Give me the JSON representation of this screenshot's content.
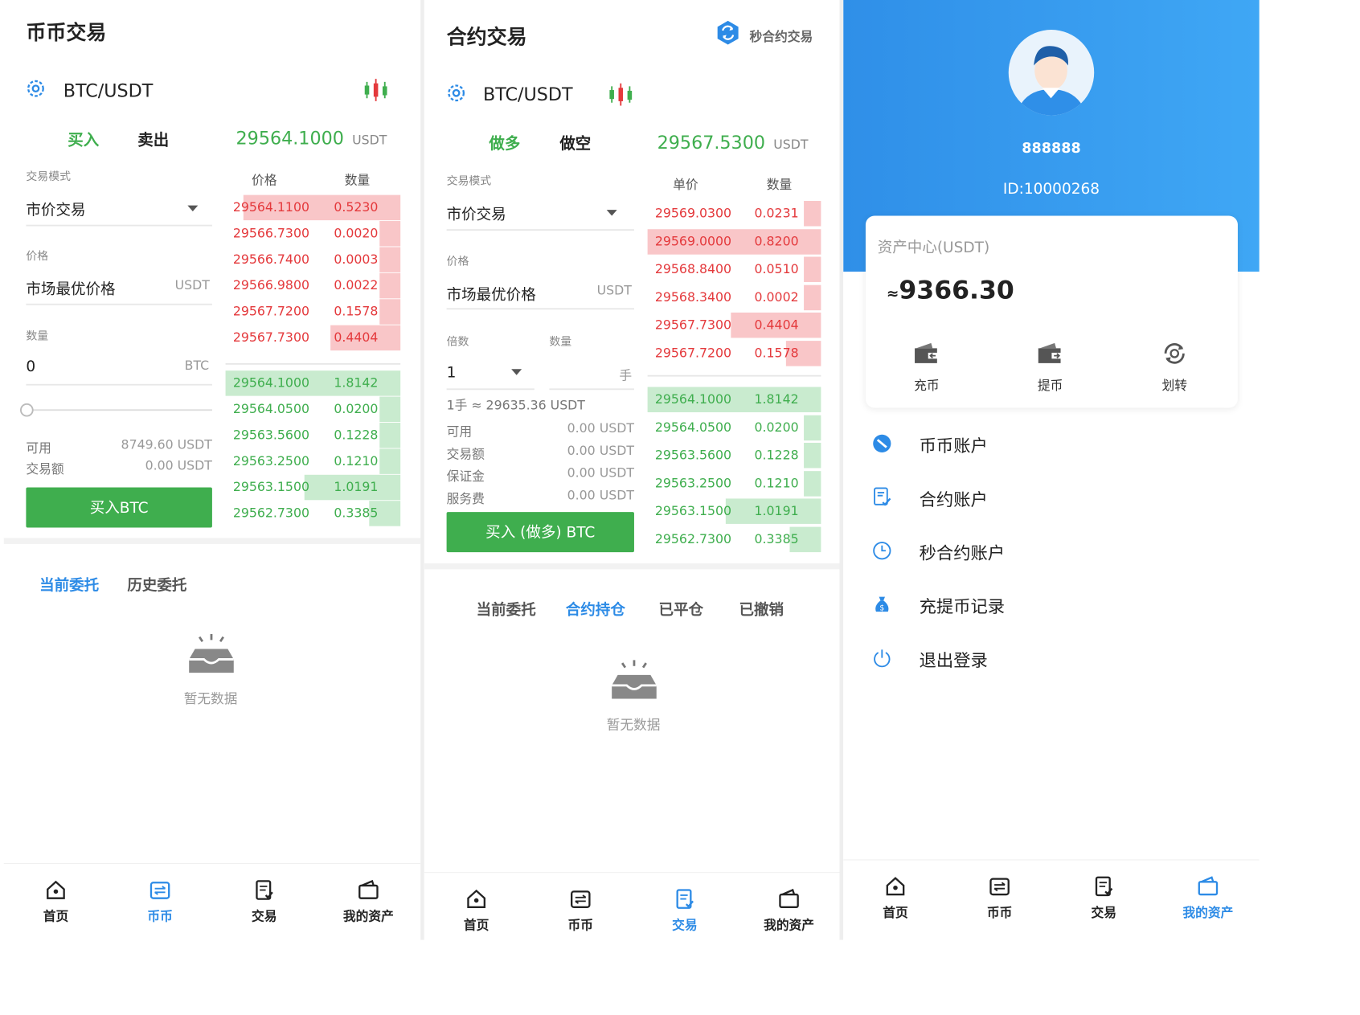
{
  "colors": {
    "green": "#3fae4e",
    "red": "#e4393c",
    "blue": "#2d8be6",
    "ask_bg": "#f9c6c8",
    "bid_bg": "#c9ebcf"
  },
  "spot": {
    "title": "币币交易",
    "pair": "BTC/USDT",
    "tab_buy": "买入",
    "tab_sell": "卖出",
    "last_price": "29564.1000",
    "price_unit": "USDT",
    "mode_label": "交易模式",
    "mode_value": "市价交易",
    "price_label": "价格",
    "price_value": "市场最优价格",
    "price_field_unit": "USDT",
    "qty_label": "数量",
    "qty_value": "0",
    "qty_unit": "BTC",
    "available_label": "可用",
    "available_value": "8749.60 USDT",
    "amount_label": "交易额",
    "amount_value": "0.00 USDT",
    "submit": "买入BTC",
    "ob_head_price": "价格",
    "ob_head_qty": "数量",
    "asks": [
      {
        "price": "29564.1100",
        "qty": "0.5230",
        "depth": 0.9
      },
      {
        "price": "29566.7300",
        "qty": "0.0020",
        "depth": 0.12
      },
      {
        "price": "29566.7400",
        "qty": "0.0003",
        "depth": 0.12
      },
      {
        "price": "29566.9800",
        "qty": "0.0022",
        "depth": 0.12
      },
      {
        "price": "29567.7200",
        "qty": "0.1578",
        "depth": 0.12
      },
      {
        "price": "29567.7300",
        "qty": "0.4404",
        "depth": 0.4
      }
    ],
    "bids": [
      {
        "price": "29564.1000",
        "qty": "1.8142",
        "depth": 1.0
      },
      {
        "price": "29564.0500",
        "qty": "0.0200",
        "depth": 0.12
      },
      {
        "price": "29563.5600",
        "qty": "0.1228",
        "depth": 0.12
      },
      {
        "price": "29563.2500",
        "qty": "0.1210",
        "depth": 0.12
      },
      {
        "price": "29563.1500",
        "qty": "1.0191",
        "depth": 0.55
      },
      {
        "price": "29562.7300",
        "qty": "0.3385",
        "depth": 0.18
      }
    ],
    "orders_tabs": [
      "当前委托",
      "历史委托"
    ],
    "empty": "暂无数据"
  },
  "futures": {
    "title": "合约交易",
    "second_contract": "秒合约交易",
    "pair": "BTC/USDT",
    "tab_long": "做多",
    "tab_short": "做空",
    "last_price": "29567.5300",
    "price_unit": "USDT",
    "mode_label": "交易模式",
    "mode_value": "市价交易",
    "price_label": "价格",
    "price_value": "市场最优价格",
    "price_field_unit": "USDT",
    "leverage_label": "倍数",
    "leverage_value": "1",
    "qty_label": "数量",
    "qty_unit": "手",
    "lot_note": "1手 ≈ 29635.36 USDT",
    "info": [
      {
        "label": "可用",
        "value": "0.00 USDT"
      },
      {
        "label": "交易额",
        "value": "0.00 USDT"
      },
      {
        "label": "保证金",
        "value": "0.00 USDT"
      },
      {
        "label": "服务费",
        "value": "0.00 USDT"
      }
    ],
    "submit": "买入 (做多) BTC",
    "ob_head_price": "单价",
    "ob_head_qty": "数量",
    "asks": [
      {
        "price": "29569.0300",
        "qty": "0.0231",
        "depth": 0.1
      },
      {
        "price": "29569.0000",
        "qty": "0.8200",
        "depth": 1.0
      },
      {
        "price": "29568.8400",
        "qty": "0.0510",
        "depth": 0.1
      },
      {
        "price": "29568.3400",
        "qty": "0.0002",
        "depth": 0.1
      },
      {
        "price": "29567.7300",
        "qty": "0.4404",
        "depth": 0.52
      },
      {
        "price": "29567.7200",
        "qty": "0.1578",
        "depth": 0.2
      }
    ],
    "bids": [
      {
        "price": "29564.1000",
        "qty": "1.8142",
        "depth": 1.0
      },
      {
        "price": "29564.0500",
        "qty": "0.0200",
        "depth": 0.1
      },
      {
        "price": "29563.5600",
        "qty": "0.1228",
        "depth": 0.1
      },
      {
        "price": "29563.2500",
        "qty": "0.1210",
        "depth": 0.1
      },
      {
        "price": "29563.1500",
        "qty": "1.0191",
        "depth": 0.55
      },
      {
        "price": "29562.7300",
        "qty": "0.3385",
        "depth": 0.18
      }
    ],
    "orders_tabs": [
      "当前委托",
      "合约持仓",
      "已平仓",
      "已撤销"
    ],
    "empty": "暂无数据"
  },
  "assets": {
    "username": "888888",
    "user_id": "ID:10000268",
    "center_title": "资产中心(USDT)",
    "total_prefix": "≈",
    "total": "9366.30",
    "actions": [
      {
        "label": "充币",
        "icon": "wallet-in-icon"
      },
      {
        "label": "提币",
        "icon": "wallet-out-icon"
      },
      {
        "label": "划转",
        "icon": "transfer-icon"
      }
    ],
    "menu": [
      {
        "label": "币币账户",
        "icon": "coin-account-icon"
      },
      {
        "label": "合约账户",
        "icon": "contract-account-icon"
      },
      {
        "label": "秒合约账户",
        "icon": "clock-icon"
      },
      {
        "label": "充提币记录",
        "icon": "money-bag-icon"
      },
      {
        "label": "退出登录",
        "icon": "power-icon"
      }
    ]
  },
  "nav": [
    "首页",
    "币币",
    "交易",
    "我的资产"
  ]
}
